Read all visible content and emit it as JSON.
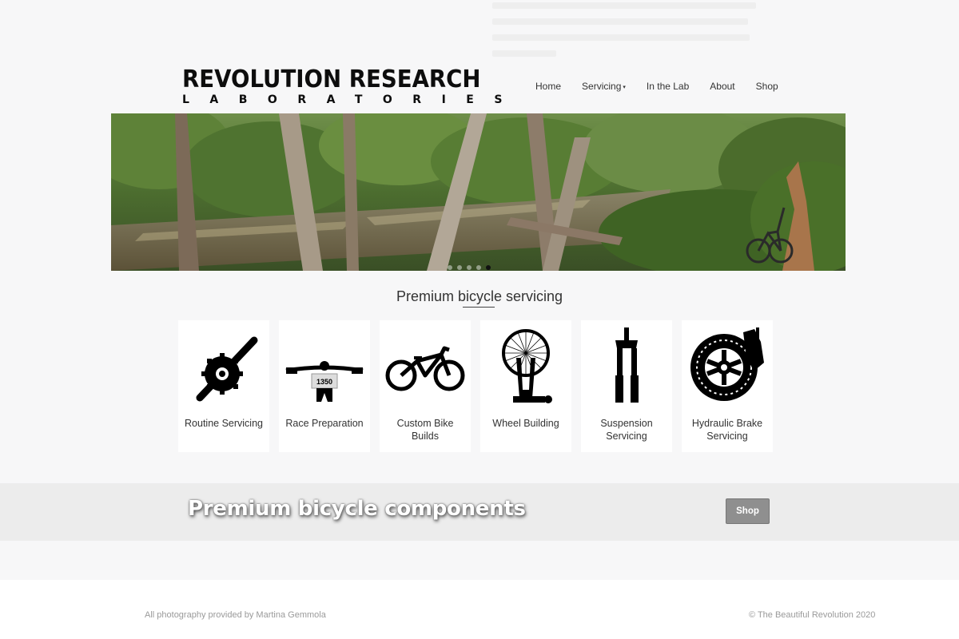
{
  "brand": {
    "name_line1": "REVOLUTION RESEARCH",
    "name_line2": "LABORATORIES"
  },
  "nav": {
    "items": [
      {
        "label": "Home"
      },
      {
        "label": "Servicing",
        "has_dropdown": true,
        "caret": "▾"
      },
      {
        "label": "In the Lab"
      },
      {
        "label": "About"
      },
      {
        "label": "Shop"
      }
    ]
  },
  "hero": {
    "slide_count": 5,
    "active_slide": 4
  },
  "services": {
    "title": "Premium bicycle servicing",
    "cards": [
      {
        "label": "Routine Servicing",
        "icon": "crankset-icon"
      },
      {
        "label": "Race Preparation",
        "icon": "race-handlebar-icon",
        "plate_number": "1350"
      },
      {
        "label": "Custom Bike Builds",
        "icon": "mountain-bike-icon"
      },
      {
        "label": "Wheel Building",
        "icon": "wheel-truing-stand-icon"
      },
      {
        "label": "Suspension Servicing",
        "icon": "suspension-fork-icon"
      },
      {
        "label": "Hydraulic Brake Servicing",
        "icon": "brake-rotor-icon"
      }
    ]
  },
  "components_banner": {
    "text": "Premium bicycle components",
    "button_label": "Shop"
  },
  "footer": {
    "credit": "All photography provided by Martina Gemmola",
    "copyright": "© The Beautiful Revolution 2020"
  },
  "colors": {
    "page_bg": "#f7f7f8",
    "banner_bg": "#ececec",
    "button_bg": "#8f8f8f",
    "text": "#333333",
    "footer_text": "#9a9a9a"
  }
}
